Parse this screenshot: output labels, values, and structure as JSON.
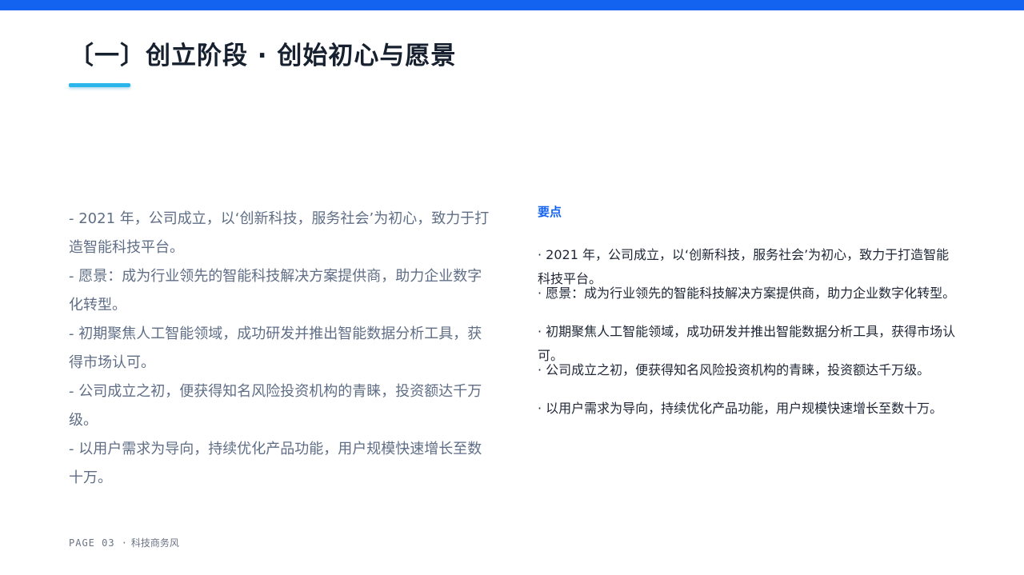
{
  "title": "〔一〕创立阶段 · 创始初心与愿景",
  "left_items": [
    "- 2021 年，公司成立，以‘创新科技，服务社会’为初心，致力于打造智能科技平台。",
    "- 愿景：成为行业领先的智能科技解决方案提供商，助力企业数字化转型。",
    "- 初期聚焦人工智能领域，成功研发并推出智能数据分析工具，获得市场认可。",
    "- 公司成立之初，便获得知名风险投资机构的青睐，投资额达千万级。",
    "- 以用户需求为导向，持续优化产品功能，用户规模快速增长至数十万。"
  ],
  "points_label": "要点",
  "right_items": [
    "· 2021 年，公司成立，以‘创新科技，服务社会’为初心，致力于打造智能科技平台。",
    "· 愿景：成为行业领先的智能科技解决方案提供商，助力企业数字化转型。",
    "· 初期聚焦人工智能领域，成功研发并推出智能数据分析工具，获得市场认可。",
    "· 公司成立之初，便获得知名风险投资机构的青睐，投资额达千万级。",
    "· 以用户需求为导向，持续优化产品功能，用户规模快速增长至数十万。"
  ],
  "footer": {
    "page": "PAGE 03 ·",
    "label": "科技商务风"
  },
  "colors": {
    "accent": "#1463f0",
    "underline": "#2ab6ea"
  }
}
